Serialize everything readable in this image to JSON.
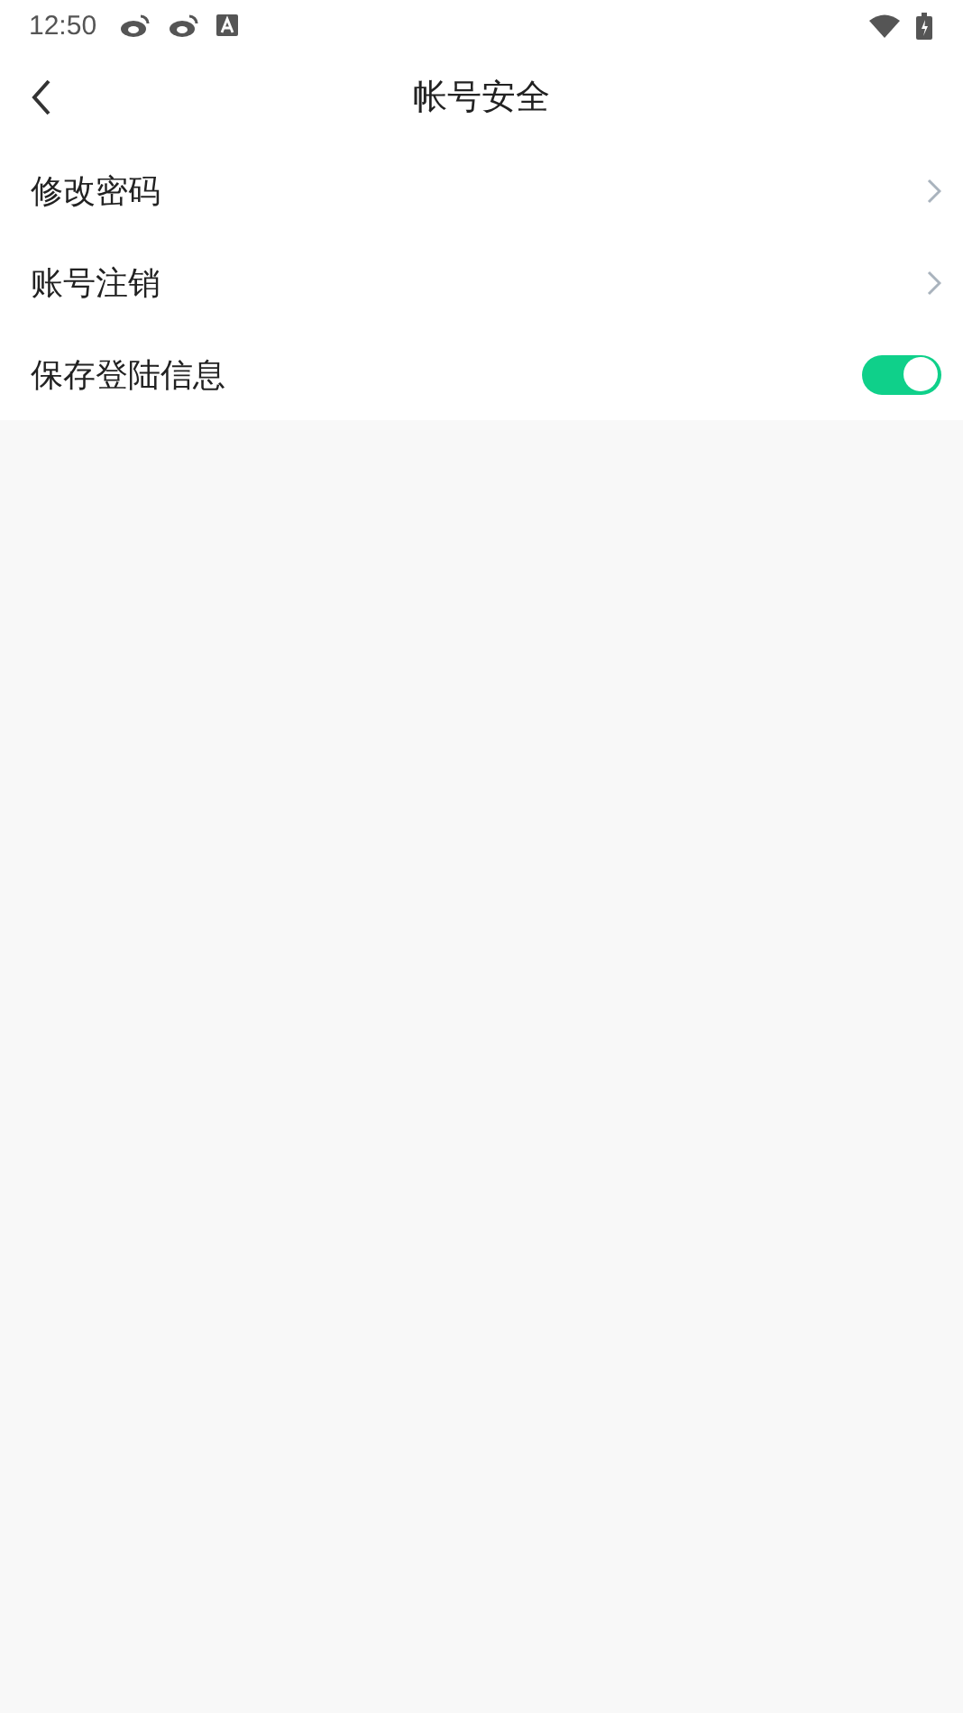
{
  "status_bar": {
    "time": "12:50"
  },
  "header": {
    "title": "帐号安全"
  },
  "rows": [
    {
      "kind": "link",
      "label": "修改密码"
    },
    {
      "kind": "link",
      "label": "账号注销"
    },
    {
      "kind": "toggle",
      "label": "保存登陆信息",
      "on": true
    }
  ]
}
